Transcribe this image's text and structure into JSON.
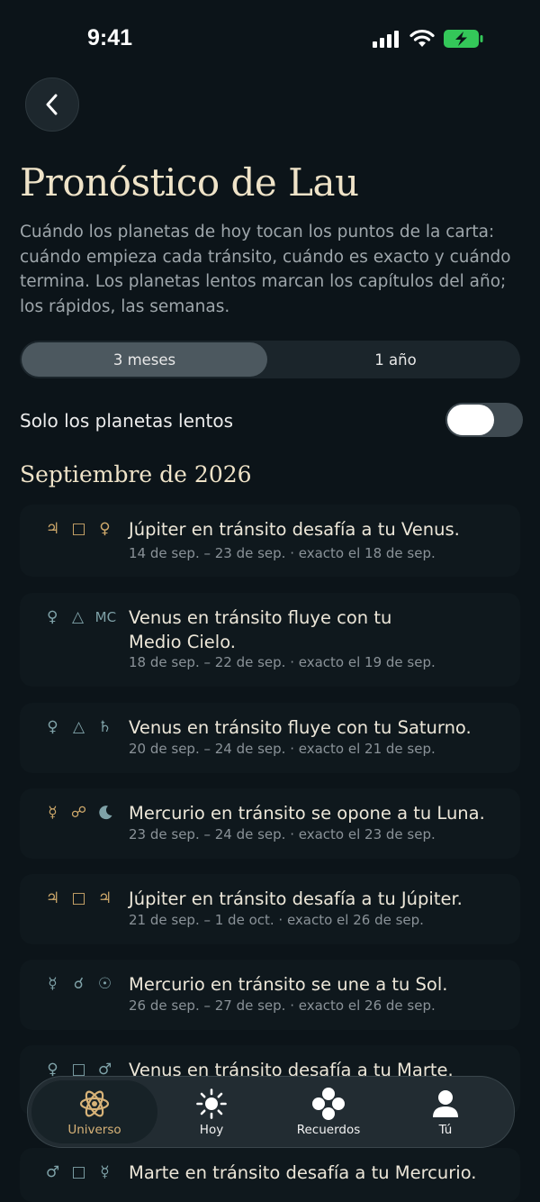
{
  "status_bar": {
    "time": "9:41"
  },
  "header": {
    "title": "Pronóstico de Lau",
    "description": "Cuándo los planetas de hoy tocan los puntos de la carta: cuándo empieza cada tránsito, cuándo es exacto y cuándo termina. Los planetas lentos marcan los capítulos del año; los rápidos, las semanas."
  },
  "segmented": {
    "option_1": "3 meses",
    "option_2": "1 año",
    "selected": "3 meses"
  },
  "toggle": {
    "label": "Solo los planetas lentos",
    "on": false
  },
  "month_title": "Septiembre de 2026",
  "transits": [
    {
      "g1": "♃",
      "g2": "□",
      "g3": "♀",
      "title": "Júpiter en tránsito desafía a tu Venus.",
      "date": "14 de sep. – 23 de sep. · exacto el 18 de sep."
    },
    {
      "g1": "♀",
      "g2": "△",
      "g3": "MC",
      "title": "Venus en tránsito fluye con tu Medio Cielo.",
      "date": "18 de sep. – 22 de sep. · exacto el 19 de sep."
    },
    {
      "g1": "♀",
      "g2": "△",
      "g3": "♄",
      "title": "Venus en tránsito fluye con tu Saturno.",
      "date": "20 de sep. – 24 de sep. · exacto el 21 de sep."
    },
    {
      "g1": "☿",
      "g2": "☍",
      "g3": "☾",
      "title": "Mercurio en tránsito se opone a tu Luna.",
      "date": "23 de sep. – 24 de sep. · exacto el 23 de sep."
    },
    {
      "g1": "♃",
      "g2": "□",
      "g3": "♃",
      "title": "Júpiter en tránsito desafía a tu Júpiter.",
      "date": "21 de sep. – 1 de oct. · exacto el 26 de sep."
    },
    {
      "g1": "☿",
      "g2": "☌",
      "g3": "☉",
      "title": "Mercurio en tránsito se une a tu Sol.",
      "date": "26 de sep. – 27 de sep. · exacto el 26 de sep."
    },
    {
      "g1": "♀",
      "g2": "□",
      "g3": "♂",
      "title": "Venus en tránsito desafía a tu Marte.",
      "date": ""
    },
    {
      "g1": "♂",
      "g2": "□",
      "g3": "☿",
      "title": "Marte en tránsito desafía a tu Mercurio.",
      "date": ""
    }
  ],
  "tabbar": {
    "universe": "Universo",
    "today": "Hoy",
    "memories": "Recuerdos",
    "you": "Tú",
    "active": "Universo"
  },
  "colors": {
    "background": "#0c1419",
    "accent_gold": "#d8b378",
    "title_cream": "#efe3c8",
    "battery_green": "#34c759"
  }
}
